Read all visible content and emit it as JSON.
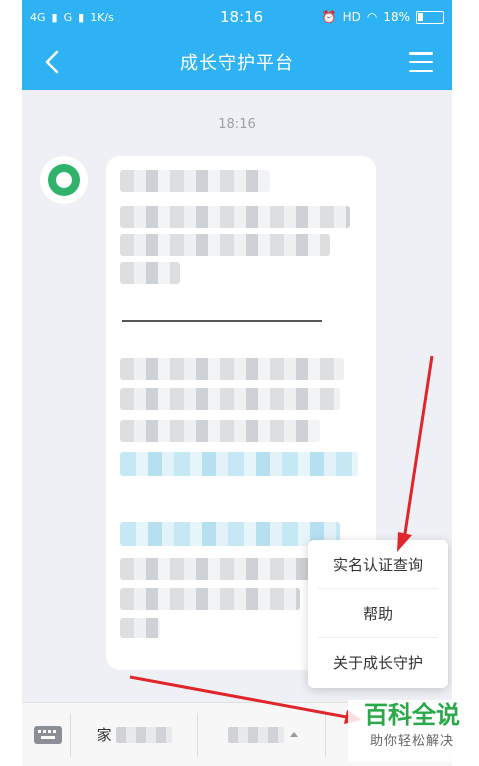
{
  "status_bar": {
    "network_left": "4G",
    "network_mid": "G",
    "speed": "1K/s",
    "time": "18:16",
    "hd": "HD",
    "battery": "18%"
  },
  "header": {
    "title": "成长守护平台"
  },
  "chat": {
    "timestamp": "18:16"
  },
  "popup_menu": {
    "items": [
      {
        "label": "实名认证查询"
      },
      {
        "label": "帮助"
      },
      {
        "label": "关于成长守护"
      }
    ]
  },
  "bottom_bar": {
    "tab1_label": "家"
  },
  "watermark": {
    "main": "百科全说",
    "sub": "助你轻松解决"
  },
  "colors": {
    "header_bg": "#2fb2f3",
    "arrow": "#e0262a",
    "watermark_green": "#2aa84a"
  }
}
